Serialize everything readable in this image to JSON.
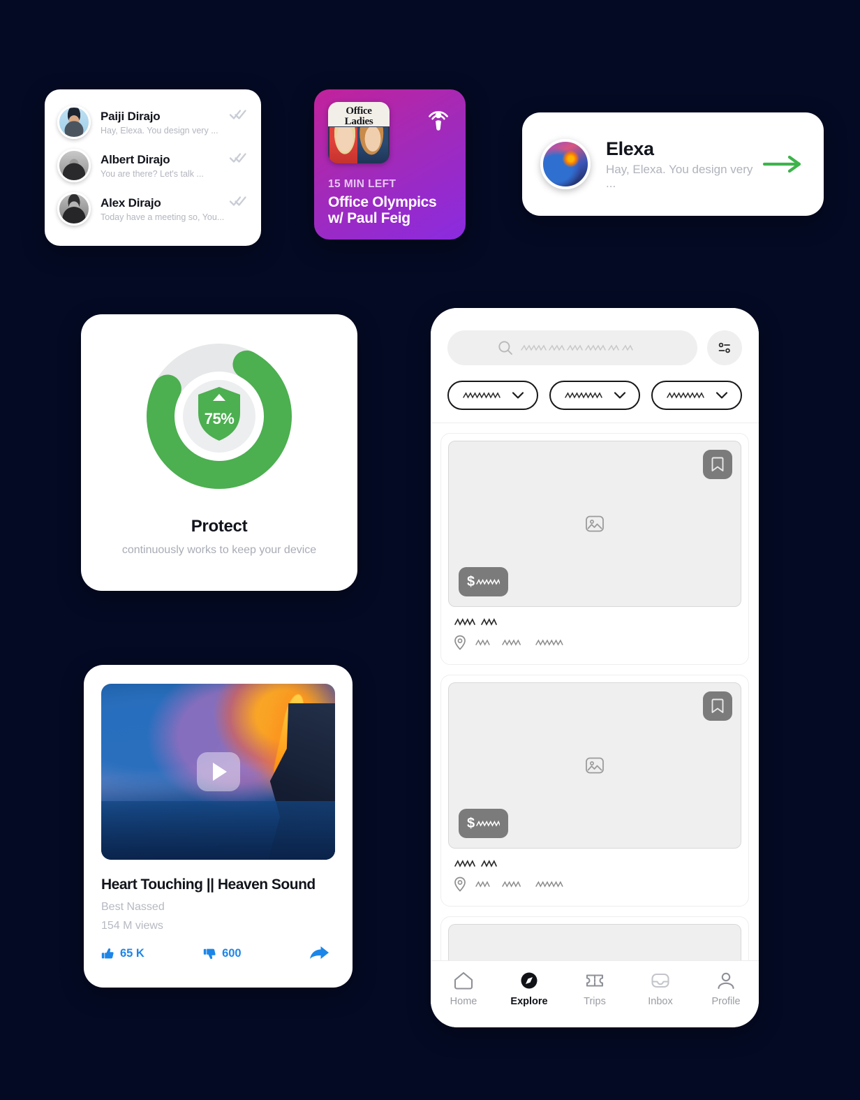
{
  "theme": {
    "background": "#040a23",
    "card_bg": "#ffffff",
    "accent_green": "#4caf50",
    "accent_blue": "#1c86e8",
    "muted_text": "#b3b6bf"
  },
  "chat_card": {
    "name": "chat-list-card",
    "rows": [
      {
        "name": "Paiji Dirajo",
        "preview": "Hay, Elexa. You design very ...",
        "status_icon": "double-check-icon"
      },
      {
        "name": "Albert Dirajo",
        "preview": "You are there? Let's talk ...",
        "status_icon": "double-check-icon"
      },
      {
        "name": "Alex Dirajo",
        "preview": "Today have a meeting so, You...",
        "status_icon": "double-check-icon"
      }
    ]
  },
  "podcast_card": {
    "artwork_title_line1": "Office",
    "artwork_title_line2": "Ladies",
    "platform_icon": "podcast-icon",
    "time_left": "15 MIN LEFT",
    "episode_title": "Office Olympics\nw/ Paul Feig",
    "episode_title_line1": "Office Olympics",
    "episode_title_line2": "w/ Paul Feig",
    "gradient_from": "#c2229b",
    "gradient_to": "#8a2be0"
  },
  "elexa_card": {
    "avatar_icon": "user-avatar",
    "name": "Elexa",
    "message": "Hay, Elexa. You design very ...",
    "action_icon": "arrow-right-icon",
    "action_color": "#3cb44a"
  },
  "protect_card": {
    "percent_label": "75%",
    "progress_value": 75,
    "title": "Protect",
    "subtitle": "continuously works to keep your device",
    "ring_color": "#4caf50",
    "ring_track_color": "#e4e6e7",
    "shield_icon": "shield-icon"
  },
  "video_card": {
    "thumbnail_icon": "lava-ocean-thumbnail",
    "play_icon": "play-icon",
    "title": "Heart Touching || Heaven Sound",
    "channel": "Best Nassed",
    "views": "154 M views",
    "like_icon": "thumbs-up-icon",
    "likes": "65 K",
    "dislike_icon": "thumbs-down-icon",
    "dislikes": "600",
    "share_icon": "share-icon"
  },
  "phone": {
    "search": {
      "icon": "search-icon",
      "placeholder": "",
      "value": ""
    },
    "filter_button_icon": "filter-sliders-icon",
    "chips": [
      {
        "label": "",
        "icon": "chevron-down-icon"
      },
      {
        "label": "",
        "icon": "chevron-down-icon"
      },
      {
        "label": "",
        "icon": "chevron-down-icon"
      }
    ],
    "listings": [
      {
        "image_placeholder_icon": "image-placeholder-icon",
        "bookmark_icon": "bookmark-icon",
        "price_prefix": "$",
        "price_value": "",
        "title": "",
        "location_icon": "map-pin-icon",
        "location": ""
      },
      {
        "image_placeholder_icon": "image-placeholder-icon",
        "bookmark_icon": "bookmark-icon",
        "price_prefix": "$",
        "price_value": "",
        "title": "",
        "location_icon": "map-pin-icon",
        "location": ""
      }
    ],
    "tabs": [
      {
        "label": "Home",
        "icon": "home-icon",
        "active": false
      },
      {
        "label": "Explore",
        "icon": "compass-icon",
        "active": true
      },
      {
        "label": "Trips",
        "icon": "ticket-icon",
        "active": false
      },
      {
        "label": "Inbox",
        "icon": "inbox-icon",
        "active": false
      },
      {
        "label": "Profile",
        "icon": "person-icon",
        "active": false
      }
    ]
  }
}
